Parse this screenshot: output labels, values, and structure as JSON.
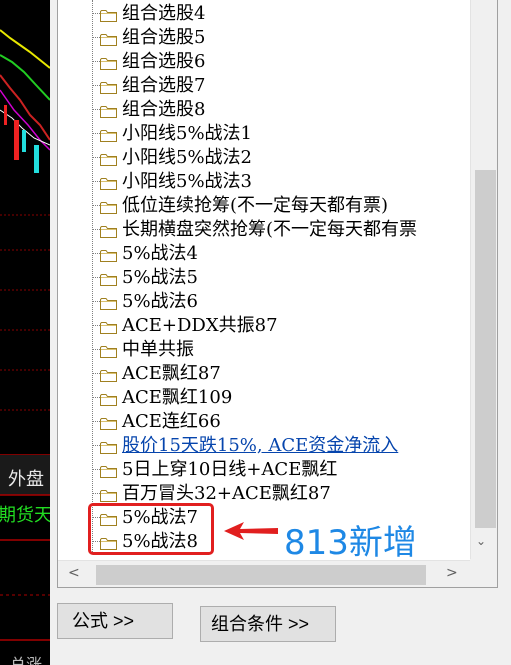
{
  "chart_side": {
    "outer_label": "外盘",
    "futures_label": "期货天",
    "bottom_label": "总涨"
  },
  "tree": {
    "items": [
      {
        "label": "组合选股4",
        "link": false
      },
      {
        "label": "组合选股5",
        "link": false
      },
      {
        "label": "组合选股6",
        "link": false
      },
      {
        "label": "组合选股7",
        "link": false
      },
      {
        "label": "组合选股8",
        "link": false
      },
      {
        "label": "小阳线5%战法1",
        "link": false
      },
      {
        "label": "小阳线5%战法2",
        "link": false
      },
      {
        "label": "小阳线5%战法3",
        "link": false
      },
      {
        "label": "低位连续抢筹(不一定每天都有票)",
        "link": false
      },
      {
        "label": "长期横盘突然抢筹(不一定每天都有票",
        "link": false
      },
      {
        "label": "5%战法4",
        "link": false
      },
      {
        "label": "5%战法5",
        "link": false
      },
      {
        "label": "5%战法6",
        "link": false
      },
      {
        "label": "ACE+DDX共振87",
        "link": false
      },
      {
        "label": "中单共振",
        "link": false
      },
      {
        "label": "ACE飘红87",
        "link": false
      },
      {
        "label": "ACE飘红109",
        "link": false
      },
      {
        "label": "ACE连红66",
        "link": false
      },
      {
        "label": "股价15天跌15%, ACE资金净流入",
        "link": true
      },
      {
        "label": "5日上穿10日线+ACE飘红",
        "link": false
      },
      {
        "label": "百万冒头32+ACE飘红87",
        "link": false
      },
      {
        "label": "5%战法7",
        "link": false
      },
      {
        "label": "5%战法8",
        "link": false
      }
    ]
  },
  "annotation": {
    "text": "813新增",
    "color": "#1e88e5",
    "box_color": "#e11f1f"
  },
  "buttons": {
    "formula": "公式 >>",
    "combo": "组合条件 >>"
  },
  "icons": {
    "folder": "folder-icon",
    "scroll_down": "chevron-down-icon",
    "scroll_left": "chevron-left-icon",
    "scroll_right": "chevron-right-icon",
    "arrow": "arrow-left-icon"
  }
}
